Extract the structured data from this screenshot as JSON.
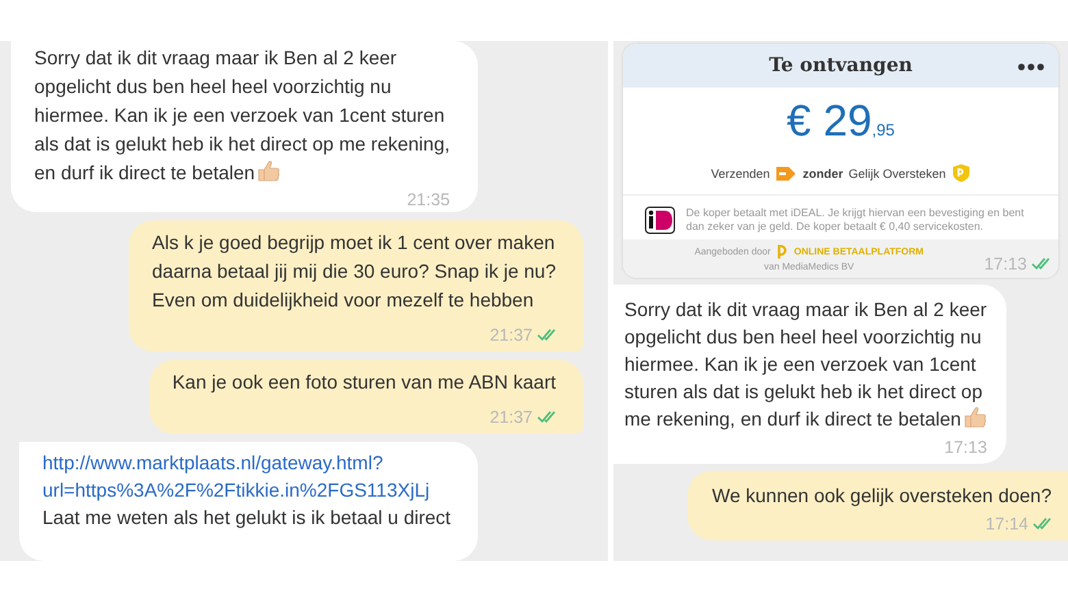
{
  "panels": [
    {
      "messages": [
        {
          "kind": "incoming",
          "lines": [
            "Sorry dat ik dit vraag maar ik Ben al 2 keer",
            "opgelicht dus ben heel heel voorzichtig nu",
            "hiermee. Kan ik je een verzoek van 1cent sturen",
            "als dat is gelukt heb ik het direct op me rekening,",
            "en durf ik direct te betalen"
          ],
          "thumbs": true,
          "time": "21:35"
        },
        {
          "kind": "outgoing",
          "lines": [
            "Als k je goed begrijp moet ik 1 cent over maken",
            "daarna betaal jij mij die 30 euro? Snap ik je nu?",
            "Even om duidelijkheid voor mezelf te hebben"
          ],
          "time": "21:37",
          "read": true
        },
        {
          "kind": "outgoing",
          "lines": [
            "Kan je ook een foto sturen van me ABN kaart"
          ],
          "time": "21:37",
          "read": true
        },
        {
          "kind": "incoming",
          "link": [
            "http://www.marktplaats.nl/gateway.html?",
            "url=https%3A%2F%2Ftikkie.in%2FGS113XjLj"
          ],
          "lines": [
            "Laat me weten als het gelukt is ik betaal u direct"
          ]
        }
      ]
    },
    {
      "messages": [
        {
          "kind": "payment",
          "title": "Te ontvangen",
          "amount": "€ 29",
          "cents": ",95",
          "shipping": "Verzenden",
          "without": "zonder",
          "method": "Gelijk Oversteken",
          "note": "De koper betaalt met iDEAL. Je krijgt hiervan een bevestiging en bent dan zeker van je geld. De koper betaalt € 0,40 servicekosten.",
          "offered": "Aangeboden door",
          "platform": "ONLINE BETAALPLATFORM",
          "company": "van MediaMedics BV",
          "time": "17:13",
          "read": true
        },
        {
          "kind": "incoming",
          "lines": [
            "Sorry dat ik dit vraag maar ik Ben al 2 keer",
            "opgelicht dus ben heel heel voorzichtig nu",
            "hiermee. Kan ik je een verzoek van 1cent",
            "sturen als dat is gelukt heb ik het direct op",
            "me rekening, en durf ik direct te betalen"
          ],
          "thumbs": true,
          "time": "17:13"
        },
        {
          "kind": "outgoing",
          "lines": [
            "We kunnen ook gelijk oversteken doen?"
          ],
          "time": "17:14",
          "read": true
        }
      ]
    }
  ]
}
